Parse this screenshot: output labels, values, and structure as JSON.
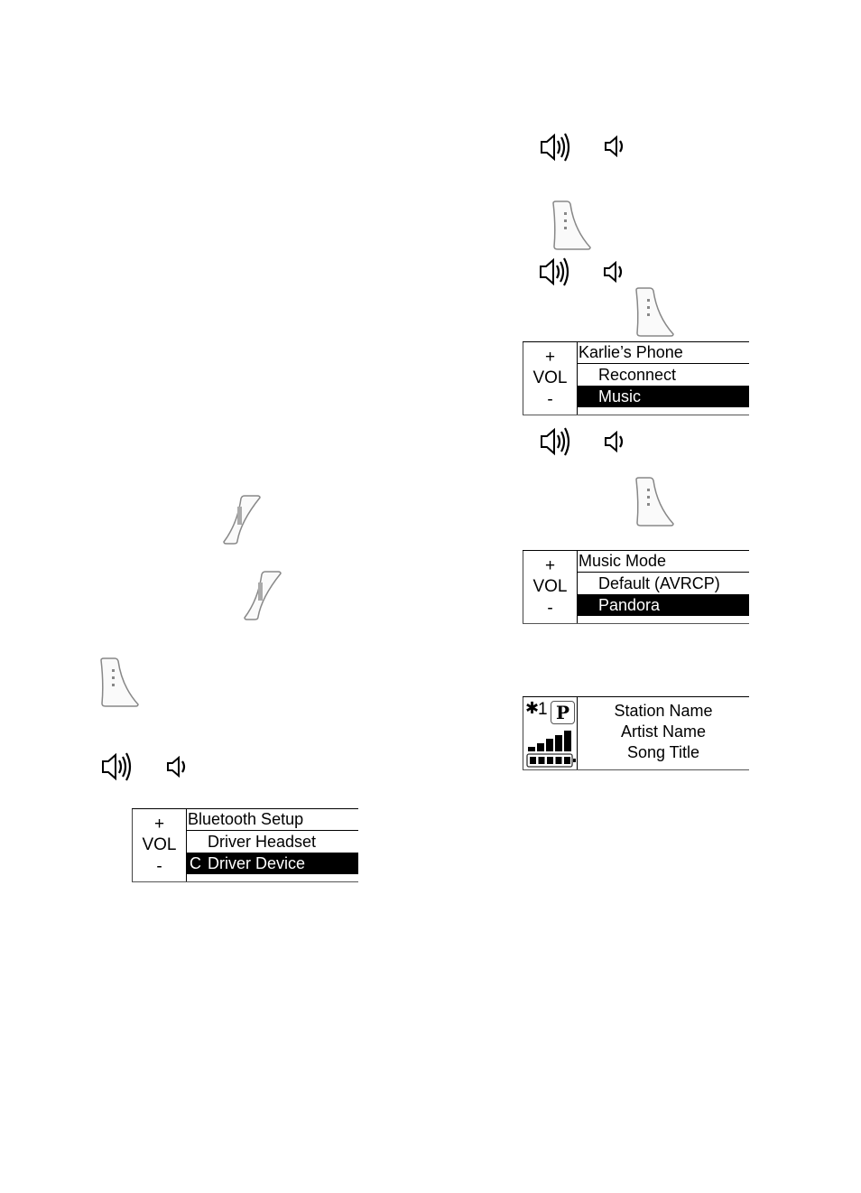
{
  "icons": {
    "volume_up": "speaker-loud-icon",
    "volume_down": "speaker-soft-icon",
    "ptt_button": "ptt-button-icon",
    "mode_button": "mode-button-icon"
  },
  "displays": {
    "karlies_phone": {
      "plus": "+",
      "vol": "VOL",
      "minus": "-",
      "header": "Karlie’s Phone",
      "rows": [
        {
          "prefix": "",
          "label": "Reconnect",
          "selected": false
        },
        {
          "prefix": "",
          "label": "Music",
          "selected": true
        }
      ]
    },
    "music_mode": {
      "plus": "+",
      "vol": "VOL",
      "minus": "-",
      "header": "Music Mode",
      "rows": [
        {
          "prefix": "",
          "label": "Default (AVRCP)",
          "selected": false
        },
        {
          "prefix": "",
          "label": "Pandora",
          "selected": true
        }
      ]
    },
    "bluetooth_setup": {
      "plus": "+",
      "vol": "VOL",
      "minus": "-",
      "header": "Bluetooth Setup",
      "rows": [
        {
          "prefix": "",
          "label": "Driver Headset",
          "selected": false
        },
        {
          "prefix": "C",
          "label": "Driver Device",
          "selected": true
        }
      ]
    }
  },
  "status_display": {
    "bluetooth_channel": "1",
    "pandora_badge": "P",
    "signal_bars": 5,
    "battery_level": 1.0,
    "lines": [
      "Station Name",
      "Artist Name",
      "Song Title"
    ]
  }
}
